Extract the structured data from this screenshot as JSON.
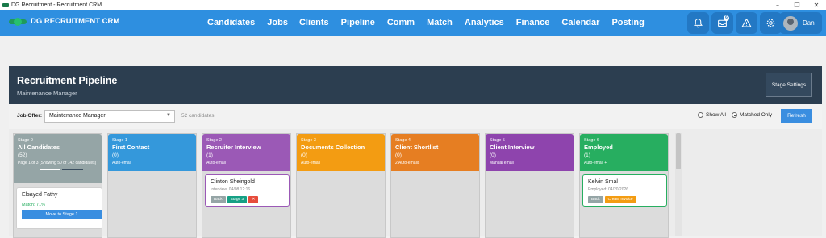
{
  "window": {
    "title": "DG Recruitment - Recruitment CRM",
    "controls": [
      "–",
      "❐",
      "✕"
    ]
  },
  "brand": {
    "name": "DG RECRUITMENT CRM"
  },
  "nav": {
    "links": [
      "Candidates",
      "Jobs",
      "Clients",
      "Pipeline",
      "Comm",
      "Match",
      "Analytics",
      "Finance",
      "Calendar",
      "Posting"
    ],
    "icons": [
      "bell-icon",
      "inbox-icon",
      "warning-icon",
      "gear-icon"
    ],
    "inbox_badge": "6",
    "user_name": "Dan"
  },
  "pipeline": {
    "title": "Recruitment Pipeline",
    "subtitle": "Maintenance Manager",
    "settings_label": "Stage Settings",
    "job_offer_label": "Job Offer:",
    "job_offer_value": "Maintenance Manager",
    "candidate_count": "52 candidates",
    "show_all_label": "Show All",
    "matched_only_label": "Matched Only",
    "refresh_label": "Refresh"
  },
  "stages": [
    {
      "stage": "Stage 0",
      "name": "All Candidates",
      "count": "(52)",
      "note": "Page 1 of 3 (Showing 50 of 142 candidates)",
      "color": "#95a5a6"
    },
    {
      "stage": "Stage 1",
      "name": "First Contact",
      "count": "(0)",
      "note": "Auto-email",
      "color": "#3498db"
    },
    {
      "stage": "Stage 2",
      "name": "Recruiter Interview",
      "count": "(1)",
      "note": "Auto-email",
      "color": "#9b59b6"
    },
    {
      "stage": "Stage 3",
      "name": "Documents Collection",
      "count": "(0)",
      "note": "Auto-email",
      "color": "#f39c12"
    },
    {
      "stage": "Stage 4",
      "name": "Client Shortlist",
      "count": "(0)",
      "note": "2 Auto-emails",
      "color": "#e67e22"
    },
    {
      "stage": "Stage 5",
      "name": "Client Interview",
      "count": "(0)",
      "note": "Manual email",
      "color": "#8e44ad"
    },
    {
      "stage": "Stage 6",
      "name": "Employed",
      "count": "(1)",
      "note": "Auto-email +",
      "color": "#27ae60"
    }
  ],
  "cards": {
    "all": {
      "name": "Elsayed Fathy",
      "match": "Match: 71%",
      "move_label": "Move to Stage 1"
    },
    "interview": {
      "name": "Clinton Sheingold",
      "sub": "Interview: 04/08 12:16",
      "back": "Back",
      "next": "Stage 3",
      "remove": "✕"
    },
    "employed": {
      "name": "Kelvin Smal",
      "sub": "Employed: 04/20/2026",
      "back": "Back",
      "invoice": "Create Invoice"
    }
  }
}
